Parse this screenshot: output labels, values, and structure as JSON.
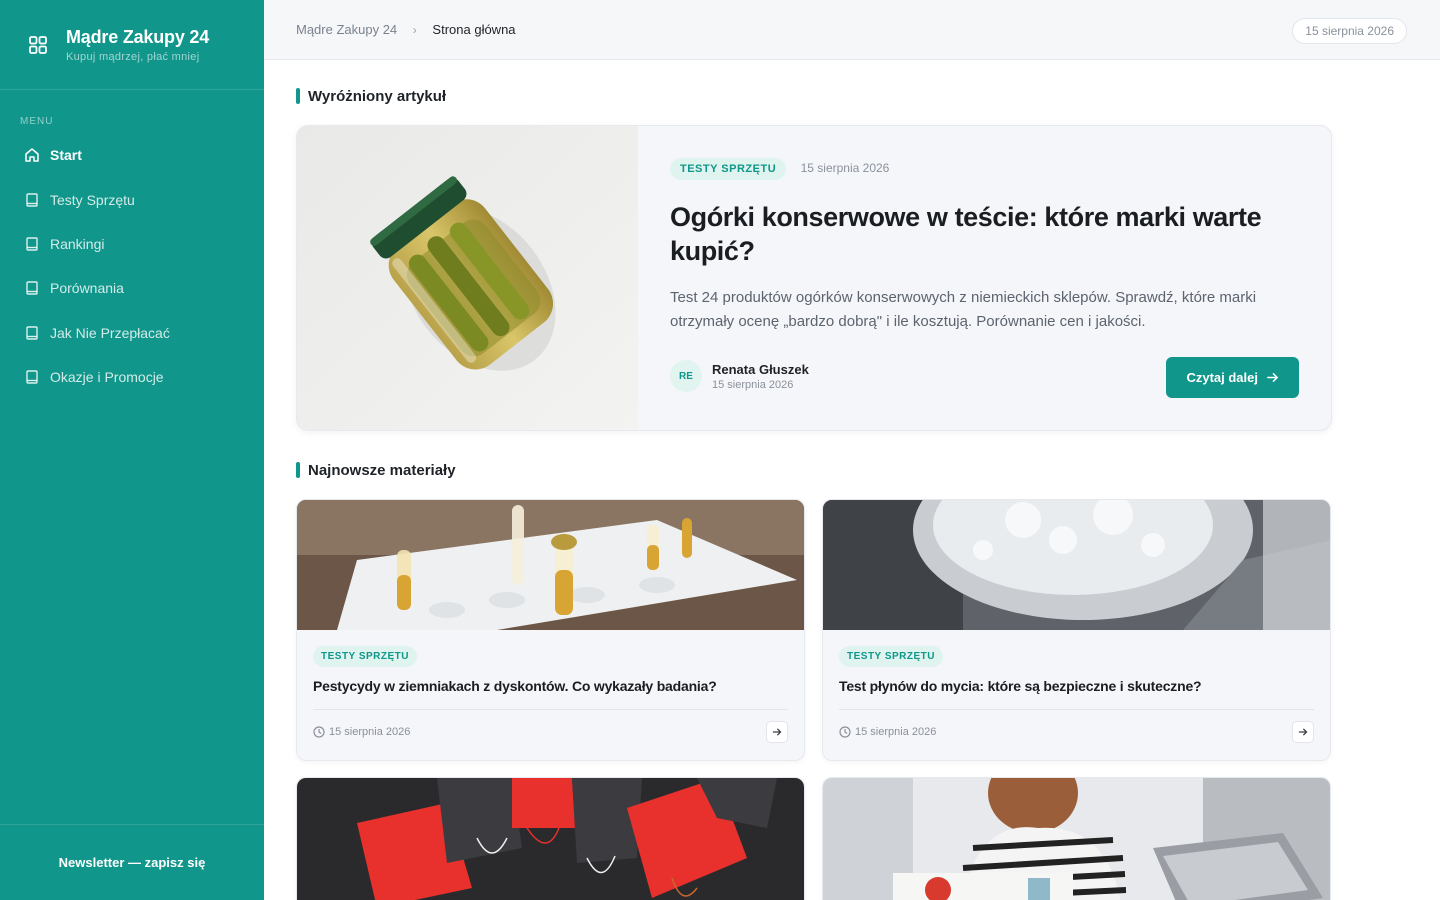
{
  "brand": {
    "title": "Mądre Zakupy 24",
    "subtitle": "Kupuj mądrzej, płać mniej",
    "icon": "grid-icon"
  },
  "sidebar": {
    "menu_label": "MENU",
    "items": [
      {
        "label": "Start",
        "icon": "home-icon",
        "active": true
      },
      {
        "label": "Testy Sprzętu",
        "icon": "book-icon",
        "active": false
      },
      {
        "label": "Rankingi",
        "icon": "book-icon",
        "active": false
      },
      {
        "label": "Porównania",
        "icon": "book-icon",
        "active": false
      },
      {
        "label": "Jak Nie Przepłacać",
        "icon": "book-icon",
        "active": false
      },
      {
        "label": "Okazje i Promocje",
        "icon": "book-icon",
        "active": false
      }
    ],
    "footer_link": "Newsletter — zapisz się"
  },
  "header": {
    "breadcrumb": {
      "root": "Mądre Zakupy 24",
      "current": "Strona główna"
    },
    "date": "15 sierpnia 2026"
  },
  "featured": {
    "section_title": "Wyróżniony artykuł",
    "tag": "TESTY SPRZĘTU",
    "date": "15 sierpnia 2026",
    "title": "Ogórki konserwowe w teście: które marki warte kupić?",
    "description": "Test 24 produktów ogórków konserwowych z niemieckich sklepów. Sprawdź, które marki otrzymały ocenę „bardzo dobrą\" i ile kosztują. Porównanie cen i jakości.",
    "author": {
      "initials": "RE",
      "name": "Renata Głuszek",
      "date": "15 sierpnia 2026"
    },
    "button": "Czytaj dalej"
  },
  "latest": {
    "section_title": "Najnowsze materiały",
    "cards": [
      {
        "tag": "TESTY SPRZĘTU",
        "title": "Pestycydy w ziemniakach z dyskontów. Co wykazały badania?",
        "date": "15 sierpnia 2026"
      },
      {
        "tag": "TESTY SPRZĘTU",
        "title": "Test płynów do mycia: które są bezpieczne i skuteczne?",
        "date": "15 sierpnia 2026"
      }
    ]
  },
  "colors": {
    "accent": "#10968a",
    "tag_bg": "#dff3ef",
    "card_bg": "#f5f6f9"
  }
}
